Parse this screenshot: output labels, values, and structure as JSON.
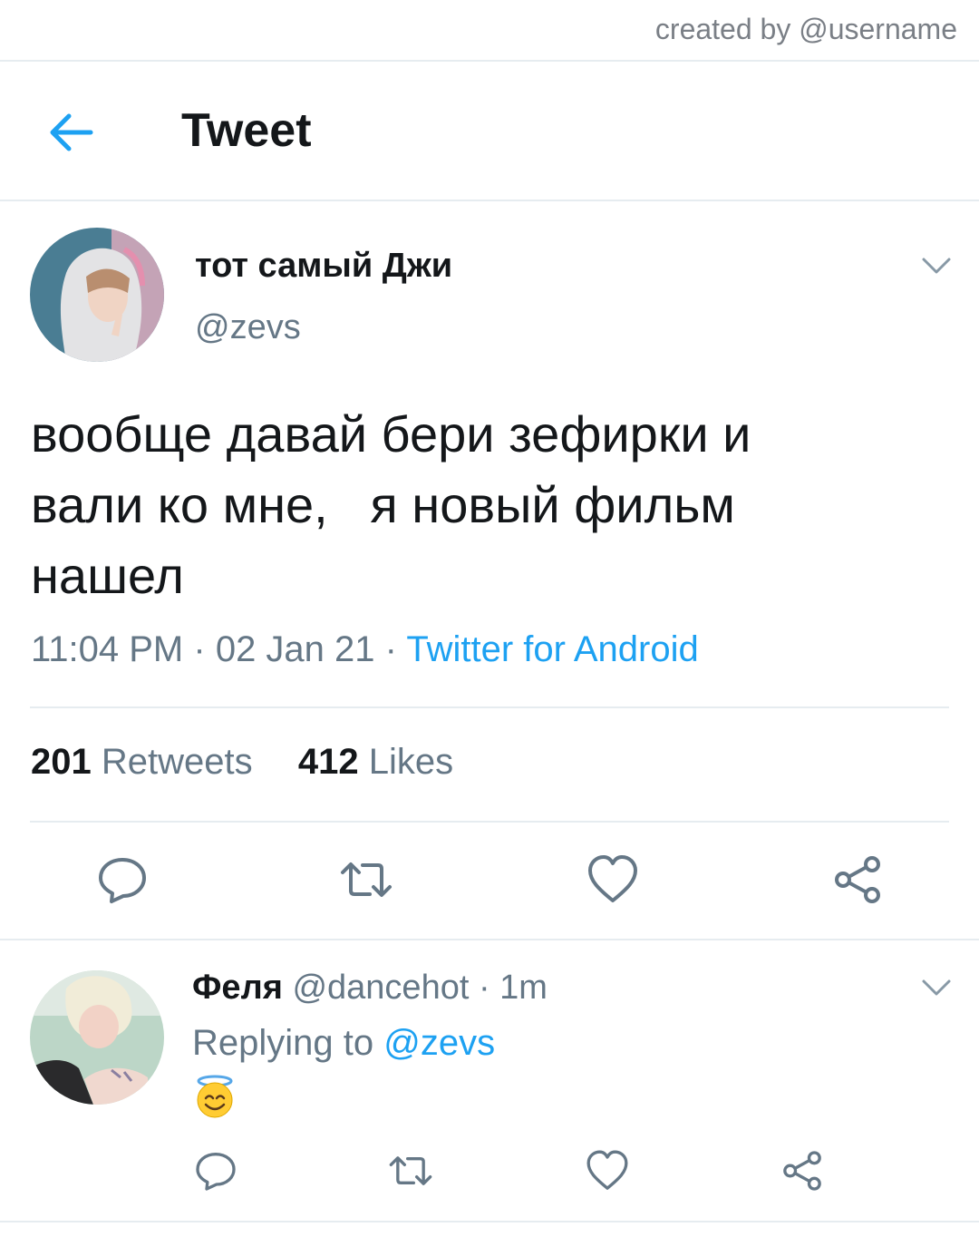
{
  "watermark": "created by @username",
  "header": {
    "title": "Tweet",
    "back_icon": "arrow-left-icon"
  },
  "tweet": {
    "author_name": "тот самый Джи",
    "author_handle": "@zevs",
    "text": "вообще давай бери зефирки и\nвали ко мне,   я новый фильм\nнашел",
    "time": "11:04 PM",
    "date": "02 Jan 21",
    "separator": "·",
    "source": "Twitter for Android",
    "retweets_count": "201",
    "retweets_label": "Retweets",
    "likes_count": "412",
    "likes_label": "Likes",
    "actions": [
      "reply-icon",
      "retweet-icon",
      "heart-icon",
      "share-icon"
    ]
  },
  "reply": {
    "author_name": "Феля",
    "author_handle": "@dancehot",
    "time_ago": "1m",
    "separator": "·",
    "replying_prefix": "Replying to",
    "replying_handle": "@zevs",
    "content_emoji": "smiling-face-with-halo"
  },
  "colors": {
    "accent": "#1da1f2",
    "text": "#14171a",
    "secondary": "#657786",
    "divider": "#e6ecf0"
  }
}
